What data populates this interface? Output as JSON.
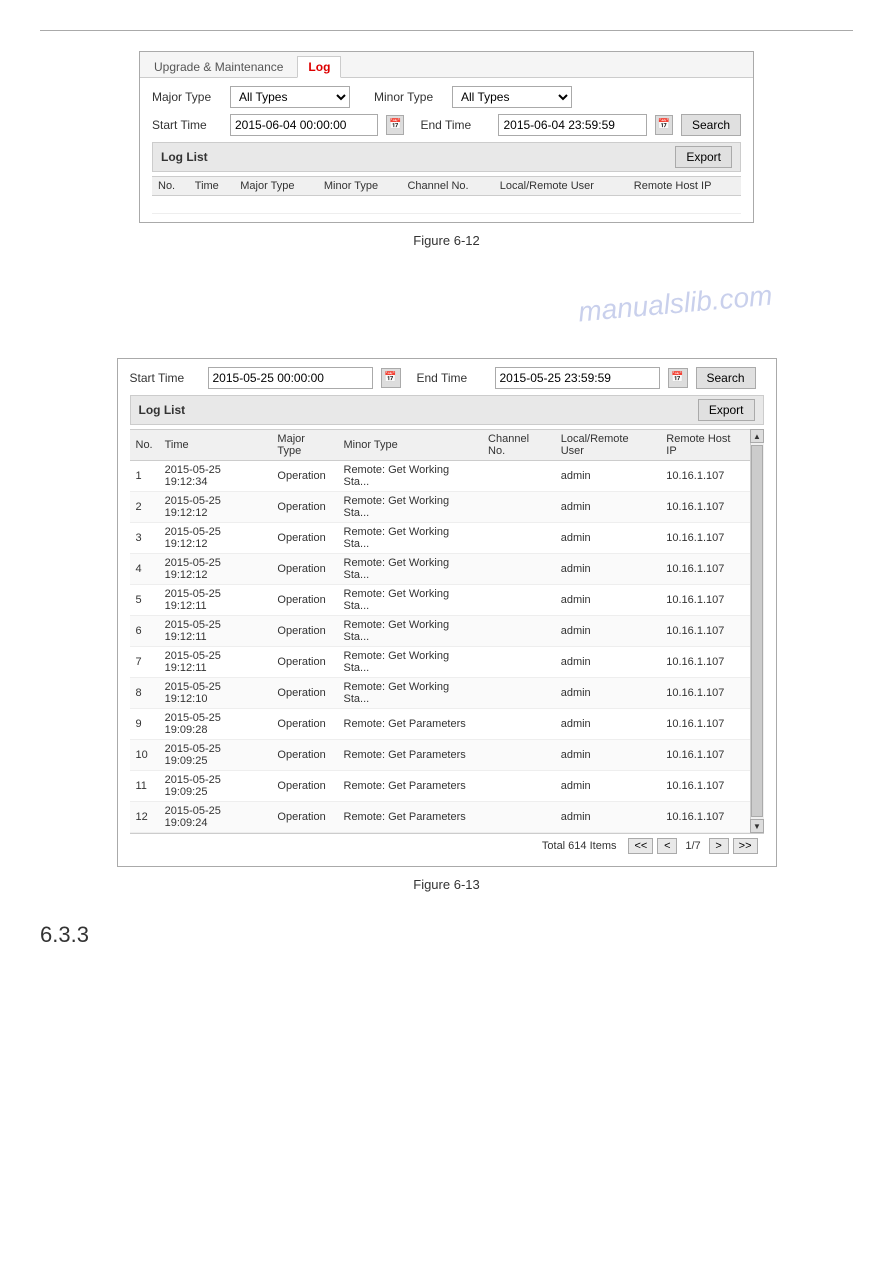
{
  "divider": true,
  "figure12": {
    "tabs": [
      {
        "label": "Upgrade & Maintenance",
        "active": false
      },
      {
        "label": "Log",
        "active": true
      }
    ],
    "form": {
      "major_type_label": "Major Type",
      "major_type_value": "All Types",
      "minor_type_label": "Minor Type",
      "minor_type_value": "All Types",
      "start_time_label": "Start Time",
      "start_time_value": "2015-06-04 00:00:00",
      "end_time_label": "End Time",
      "end_time_value": "2015-06-04 23:59:59",
      "search_label": "Search"
    },
    "log_list_label": "Log List",
    "export_label": "Export",
    "table_headers": [
      "No.",
      "Time",
      "Major Type",
      "Minor Type",
      "Channel No.",
      "Local/Remote User",
      "Remote Host IP"
    ],
    "table_rows": []
  },
  "caption12": "Figure 6-12",
  "watermark": "manualslib.com",
  "figure13": {
    "form": {
      "start_time_label": "Start Time",
      "start_time_value": "2015-05-25 00:00:00",
      "end_time_label": "End Time",
      "end_time_value": "2015-05-25 23:59:59",
      "search_label": "Search"
    },
    "log_list_label": "Log List",
    "export_label": "Export",
    "table_headers": [
      "No.",
      "Time",
      "Major Type",
      "Minor Type",
      "Channel No.",
      "Local/Remote User",
      "Remote Host IP"
    ],
    "table_rows": [
      {
        "no": "1",
        "time": "2015-05-25 19:12:34",
        "major": "Operation",
        "minor": "Remote: Get Working Sta...",
        "channel": "",
        "user": "admin",
        "ip": "10.16.1.107"
      },
      {
        "no": "2",
        "time": "2015-05-25 19:12:12",
        "major": "Operation",
        "minor": "Remote: Get Working Sta...",
        "channel": "",
        "user": "admin",
        "ip": "10.16.1.107"
      },
      {
        "no": "3",
        "time": "2015-05-25 19:12:12",
        "major": "Operation",
        "minor": "Remote: Get Working Sta...",
        "channel": "",
        "user": "admin",
        "ip": "10.16.1.107"
      },
      {
        "no": "4",
        "time": "2015-05-25 19:12:12",
        "major": "Operation",
        "minor": "Remote: Get Working Sta...",
        "channel": "",
        "user": "admin",
        "ip": "10.16.1.107"
      },
      {
        "no": "5",
        "time": "2015-05-25 19:12:11",
        "major": "Operation",
        "minor": "Remote: Get Working Sta...",
        "channel": "",
        "user": "admin",
        "ip": "10.16.1.107"
      },
      {
        "no": "6",
        "time": "2015-05-25 19:12:11",
        "major": "Operation",
        "minor": "Remote: Get Working Sta...",
        "channel": "",
        "user": "admin",
        "ip": "10.16.1.107"
      },
      {
        "no": "7",
        "time": "2015-05-25 19:12:11",
        "major": "Operation",
        "minor": "Remote: Get Working Sta...",
        "channel": "",
        "user": "admin",
        "ip": "10.16.1.107"
      },
      {
        "no": "8",
        "time": "2015-05-25 19:12:10",
        "major": "Operation",
        "minor": "Remote: Get Working Sta...",
        "channel": "",
        "user": "admin",
        "ip": "10.16.1.107"
      },
      {
        "no": "9",
        "time": "2015-05-25 19:09:28",
        "major": "Operation",
        "minor": "Remote: Get Parameters",
        "channel": "",
        "user": "admin",
        "ip": "10.16.1.107"
      },
      {
        "no": "10",
        "time": "2015-05-25 19:09:25",
        "major": "Operation",
        "minor": "Remote: Get Parameters",
        "channel": "",
        "user": "admin",
        "ip": "10.16.1.107"
      },
      {
        "no": "11",
        "time": "2015-05-25 19:09:25",
        "major": "Operation",
        "minor": "Remote: Get Parameters",
        "channel": "",
        "user": "admin",
        "ip": "10.16.1.107"
      },
      {
        "no": "12",
        "time": "2015-05-25 19:09:24",
        "major": "Operation",
        "minor": "Remote: Get Parameters",
        "channel": "",
        "user": "admin",
        "ip": "10.16.1.107"
      }
    ],
    "pagination": {
      "total_text": "Total 614 Items",
      "current_page": "1/7",
      "btn_first": "<<",
      "btn_prev": "<",
      "btn_next": ">",
      "btn_last": ">>"
    }
  },
  "caption13": "Figure 6-13",
  "section_633": "6.3.3"
}
